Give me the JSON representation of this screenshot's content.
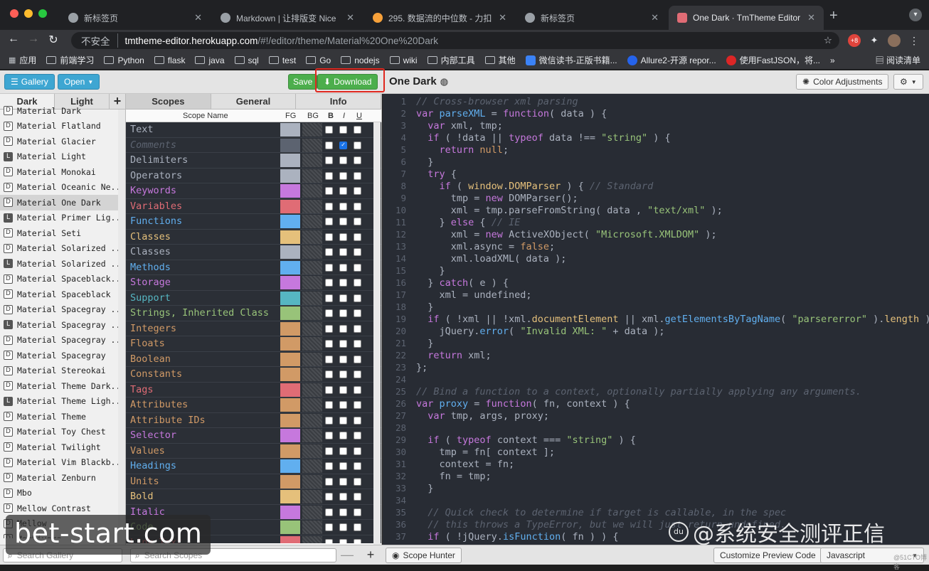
{
  "browser": {
    "tabs": [
      {
        "title": "新标签页",
        "active": false
      },
      {
        "title": "Markdown | 让排版变 Nice",
        "active": false
      },
      {
        "title": "295. 数据流的中位数 - 力扣（Le",
        "active": false
      },
      {
        "title": "新标签页",
        "active": false
      },
      {
        "title": "One Dark · TmTheme Editor",
        "active": true
      }
    ],
    "address": {
      "security": "不安全",
      "host": "tmtheme-editor.herokuapp.com",
      "path": "/#!/editor/theme/Material%20One%20Dark"
    },
    "bookmarks": [
      "应用",
      "前端学习",
      "Python",
      "flask",
      "java",
      "sql",
      "test",
      "Go",
      "nodejs",
      "wiki",
      "内部工具",
      "其他",
      "微信读书-正版书籍...",
      "Allure2-开源 repor...",
      "使用FastJSON，将..."
    ],
    "bookmarks_more": "»",
    "reading_list": "阅读清单",
    "ext_badge": "+8"
  },
  "toolbar": {
    "gallery_label": "Gallery",
    "open_label": "Open",
    "save_label": "Save",
    "download_label": "Download",
    "theme_title": "One Dark",
    "color_adjust_label": "Color Adjustments"
  },
  "gallery": {
    "tabs": [
      "Dark",
      "Light",
      "+"
    ],
    "items": [
      {
        "kind": "D",
        "name": "Material Dark"
      },
      {
        "kind": "D",
        "name": "Material Flatland"
      },
      {
        "kind": "D",
        "name": "Material Glacier"
      },
      {
        "kind": "L",
        "name": "Material Light"
      },
      {
        "kind": "D",
        "name": "Material Monokai"
      },
      {
        "kind": "D",
        "name": "Material Oceanic Ne..."
      },
      {
        "kind": "D",
        "name": "Material One Dark",
        "selected": true
      },
      {
        "kind": "L",
        "name": "Material Primer Lig..."
      },
      {
        "kind": "D",
        "name": "Material Seti"
      },
      {
        "kind": "D",
        "name": "Material Solarized ..."
      },
      {
        "kind": "L",
        "name": "Material Solarized ..."
      },
      {
        "kind": "D",
        "name": "Material Spaceblack..."
      },
      {
        "kind": "D",
        "name": "Material Spaceblack"
      },
      {
        "kind": "D",
        "name": "Material Spacegray ..."
      },
      {
        "kind": "L",
        "name": "Material Spacegray ..."
      },
      {
        "kind": "D",
        "name": "Material Spacegray ..."
      },
      {
        "kind": "D",
        "name": "Material Spacegray"
      },
      {
        "kind": "D",
        "name": "Material Stereokai"
      },
      {
        "kind": "D",
        "name": "Material Theme Dark..."
      },
      {
        "kind": "L",
        "name": "Material Theme Ligh..."
      },
      {
        "kind": "D",
        "name": "Material Theme"
      },
      {
        "kind": "D",
        "name": "Material Toy Chest"
      },
      {
        "kind": "D",
        "name": "Material Twilight"
      },
      {
        "kind": "D",
        "name": "Material Vim Blackb..."
      },
      {
        "kind": "D",
        "name": "Material Zenburn"
      },
      {
        "kind": "D",
        "name": "Mbo"
      },
      {
        "kind": "D",
        "name": "Mellow Contrast"
      },
      {
        "kind": "D",
        "name": "Mellow"
      },
      {
        "kind": "D",
        "name": "Merbivore"
      }
    ],
    "search_placeholder": "Search Gallery"
  },
  "scopes": {
    "tabs": [
      "Scopes",
      "General",
      "Info"
    ],
    "headers": {
      "name": "Scope Name",
      "fg": "FG",
      "bg": "BG",
      "b": "B",
      "i": "I",
      "u": "U"
    },
    "rows": [
      {
        "name": "Text",
        "color": "#abb2bf",
        "fg": "#abb2bf",
        "italic": false
      },
      {
        "name": "Comments",
        "color": "#5c6370",
        "fg": "#5c6370",
        "italic": true
      },
      {
        "name": "Delimiters",
        "color": "#abb2bf",
        "fg": "#abb2bf",
        "italic": false
      },
      {
        "name": "Operators",
        "color": "#abb2bf",
        "fg": "#abb2bf",
        "italic": false
      },
      {
        "name": "Keywords",
        "color": "#c678dd",
        "fg": "#c678dd",
        "italic": false
      },
      {
        "name": "Variables",
        "color": "#e06c75",
        "fg": "#e06c75",
        "italic": false
      },
      {
        "name": "Functions",
        "color": "#61afef",
        "fg": "#61afef",
        "italic": false
      },
      {
        "name": "Classes",
        "color": "#e5c07b",
        "fg": "#e5c07b",
        "italic": false
      },
      {
        "name": "Classes",
        "color": "#abb2bf",
        "fg": "#abb2bf",
        "italic": false
      },
      {
        "name": "Methods",
        "color": "#61afef",
        "fg": "#61afef",
        "italic": false
      },
      {
        "name": "Storage",
        "color": "#c678dd",
        "fg": "#c678dd",
        "italic": false
      },
      {
        "name": "Support",
        "color": "#56b6c2",
        "fg": "#56b6c2",
        "italic": false
      },
      {
        "name": "Strings, Inherited Class",
        "color": "#98c379",
        "fg": "#98c379",
        "italic": false
      },
      {
        "name": "Integers",
        "color": "#d19a66",
        "fg": "#d19a66",
        "italic": false
      },
      {
        "name": "Floats",
        "color": "#d19a66",
        "fg": "#d19a66",
        "italic": false
      },
      {
        "name": "Boolean",
        "color": "#d19a66",
        "fg": "#d19a66",
        "italic": false
      },
      {
        "name": "Constants",
        "color": "#d19a66",
        "fg": "#d19a66",
        "italic": false
      },
      {
        "name": "Tags",
        "color": "#e06c75",
        "fg": "#e06c75",
        "italic": false
      },
      {
        "name": "Attributes",
        "color": "#d19a66",
        "fg": "#d19a66",
        "italic": false
      },
      {
        "name": "Attribute IDs",
        "color": "#d19a66",
        "fg": "#d19a66",
        "italic": false
      },
      {
        "name": "Selector",
        "color": "#c678dd",
        "fg": "#c678dd",
        "italic": false
      },
      {
        "name": "Values",
        "color": "#d19a66",
        "fg": "#d19a66",
        "italic": false
      },
      {
        "name": "Headings",
        "color": "#61afef",
        "fg": "#61afef",
        "italic": false
      },
      {
        "name": "Units",
        "color": "#d19a66",
        "fg": "#d19a66",
        "italic": false
      },
      {
        "name": "Bold",
        "color": "#e5c07b",
        "fg": "#e5c07b",
        "italic": false
      },
      {
        "name": "Italic",
        "color": "#c678dd",
        "fg": "#c678dd",
        "italic": false
      },
      {
        "name": "Code",
        "color": "#98c379",
        "fg": "#98c379",
        "italic": false
      },
      {
        "name": "Link Text",
        "color": "#e06c75",
        "fg": "#e06c75",
        "italic": false
      }
    ],
    "search_placeholder": "Search Scopes",
    "remove_label": "—",
    "add_label": "+"
  },
  "code": {
    "lines": [
      [
        [
          "c",
          "// Cross-browser xml parsing"
        ]
      ],
      [
        [
          "k",
          "var "
        ],
        [
          "f",
          "parseXML"
        ],
        [
          "p",
          " = "
        ],
        [
          "k",
          "function"
        ],
        [
          "p",
          "( data ) {"
        ]
      ],
      [
        [
          "p",
          "  "
        ],
        [
          "k",
          "var "
        ],
        [
          "p",
          "xml, tmp;"
        ]
      ],
      [
        [
          "p",
          "  "
        ],
        [
          "k",
          "if "
        ],
        [
          "p",
          "( !data || "
        ],
        [
          "k",
          "typeof "
        ],
        [
          "p",
          "data !== "
        ],
        [
          "s",
          "\"string\""
        ],
        [
          "p",
          " ) {"
        ]
      ],
      [
        [
          "p",
          "    "
        ],
        [
          "k",
          "return "
        ],
        [
          "o",
          "null"
        ],
        [
          "p",
          ";"
        ]
      ],
      [
        [
          "p",
          "  }"
        ]
      ],
      [
        [
          "p",
          "  "
        ],
        [
          "k",
          "try "
        ],
        [
          "p",
          "{"
        ]
      ],
      [
        [
          "p",
          "    "
        ],
        [
          "k",
          "if "
        ],
        [
          "p",
          "( "
        ],
        [
          "y",
          "window"
        ],
        [
          "p",
          "."
        ],
        [
          "y",
          "DOMParser"
        ],
        [
          "p",
          " ) { "
        ],
        [
          "c",
          "// Standard"
        ]
      ],
      [
        [
          "p",
          "      tmp = "
        ],
        [
          "k",
          "new "
        ],
        [
          "p",
          "DOMParser();"
        ]
      ],
      [
        [
          "p",
          "      xml = tmp.parseFromString( data , "
        ],
        [
          "s",
          "\"text/xml\""
        ],
        [
          "p",
          " );"
        ]
      ],
      [
        [
          "p",
          "    } "
        ],
        [
          "k",
          "else "
        ],
        [
          "p",
          "{ "
        ],
        [
          "c",
          "// IE"
        ]
      ],
      [
        [
          "p",
          "      xml = "
        ],
        [
          "k",
          "new "
        ],
        [
          "p",
          "ActiveXObject( "
        ],
        [
          "s",
          "\"Microsoft.XMLDOM\""
        ],
        [
          "p",
          " );"
        ]
      ],
      [
        [
          "p",
          "      xml.async = "
        ],
        [
          "o",
          "false"
        ],
        [
          "p",
          ";"
        ]
      ],
      [
        [
          "p",
          "      xml.loadXML( data );"
        ]
      ],
      [
        [
          "p",
          "    }"
        ]
      ],
      [
        [
          "p",
          "  } "
        ],
        [
          "k",
          "catch"
        ],
        [
          "p",
          "( e ) {"
        ]
      ],
      [
        [
          "p",
          "    xml = undefined;"
        ]
      ],
      [
        [
          "p",
          "  }"
        ]
      ],
      [
        [
          "p",
          "  "
        ],
        [
          "k",
          "if "
        ],
        [
          "p",
          "( !xml || !xml."
        ],
        [
          "y",
          "documentElement"
        ],
        [
          "p",
          " || xml."
        ],
        [
          "f",
          "getElementsByTagName"
        ],
        [
          "p",
          "( "
        ],
        [
          "s",
          "\"parsererror\""
        ],
        [
          "p",
          " )."
        ],
        [
          "y",
          "length"
        ],
        [
          "p",
          " )"
        ]
      ],
      [
        [
          "p",
          "    jQuery."
        ],
        [
          "f",
          "error"
        ],
        [
          "p",
          "( "
        ],
        [
          "s",
          "\"Invalid XML: \""
        ],
        [
          "p",
          " + data );"
        ]
      ],
      [
        [
          "p",
          "  }"
        ]
      ],
      [
        [
          "p",
          "  "
        ],
        [
          "k",
          "return "
        ],
        [
          "p",
          "xml;"
        ]
      ],
      [
        [
          "p",
          "};"
        ]
      ],
      [],
      [
        [
          "c",
          "// Bind a function to a context, optionally partially applying any arguments."
        ]
      ],
      [
        [
          "k",
          "var "
        ],
        [
          "f",
          "proxy"
        ],
        [
          "p",
          " = "
        ],
        [
          "k",
          "function"
        ],
        [
          "p",
          "( fn, context ) {"
        ]
      ],
      [
        [
          "p",
          "  "
        ],
        [
          "k",
          "var "
        ],
        [
          "p",
          "tmp, args, proxy;"
        ]
      ],
      [],
      [
        [
          "p",
          "  "
        ],
        [
          "k",
          "if "
        ],
        [
          "p",
          "( "
        ],
        [
          "k",
          "typeof "
        ],
        [
          "p",
          "context === "
        ],
        [
          "s",
          "\"string\""
        ],
        [
          "p",
          " ) {"
        ]
      ],
      [
        [
          "p",
          "    tmp = fn[ context ];"
        ]
      ],
      [
        [
          "p",
          "    context = fn;"
        ]
      ],
      [
        [
          "p",
          "    fn = tmp;"
        ]
      ],
      [
        [
          "p",
          "  }"
        ]
      ],
      [],
      [
        [
          "p",
          "  "
        ],
        [
          "c",
          "// Quick check to determine if target is callable, in the spec"
        ]
      ],
      [
        [
          "p",
          "  "
        ],
        [
          "c",
          "// this throws a TypeError, but we will just return undefined."
        ]
      ],
      [
        [
          "p",
          "  "
        ],
        [
          "k",
          "if "
        ],
        [
          "p",
          "( !jQuery."
        ],
        [
          "f",
          "isFunction"
        ],
        [
          "p",
          "( fn ) ) {"
        ]
      ]
    ]
  },
  "bottom": {
    "scope_hunter_label": "Scope Hunter",
    "customize_label": "Customize Preview Code",
    "language_value": "Javascript"
  },
  "watermarks": {
    "left": "bet-start.com",
    "right": "@系统安全测评正信",
    "right_logo": "du",
    "small": "@51CTO博客"
  }
}
